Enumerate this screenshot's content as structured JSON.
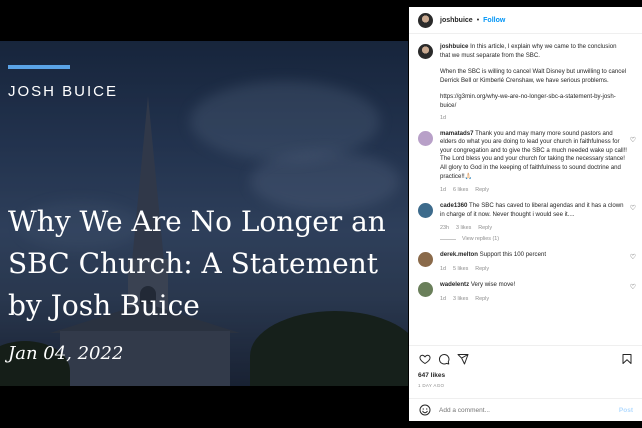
{
  "image": {
    "author": "JOSH BUICE",
    "headline": "Why We Are No Longer an SBC Church: A Statement by Josh Buice",
    "date": "Jan 04, 2022"
  },
  "header": {
    "username": "joshbuice",
    "separator": "•",
    "follow_label": "Follow"
  },
  "caption": {
    "username": "joshbuice",
    "text1": "In this article, I explain why we came to the conclusion that we must separate from the SBC.",
    "text2": "When the SBC is willing to cancel Walt Disney but unwilling to cancel Derrick Bell or Kimberlé Crenshaw, we have serious problems.",
    "link": "https://g3min.org/why-we-are-no-longer-sbc-a-statement-by-josh-buice/",
    "time": "1d"
  },
  "comments": [
    {
      "username": "mamatads7",
      "text": "Thank you and may many more sound pastors and elders do what you are doing to lead your church in faithfulness for your congregation and to give the SBC a much needed wake up call!! The Lord bless you and your church for taking the necessary stance! All glory to God in the keeping of faithfulness to sound doctrine and practice!!🙏🏻",
      "time": "1d",
      "likes": "6 likes",
      "reply": "Reply"
    },
    {
      "username": "cade1360",
      "text": "The SBC has caved to liberal agendas and it has a clown in charge of it now. Never thought i would see it....",
      "time": "23h",
      "likes": "3 likes",
      "reply": "Reply",
      "view_replies": "View replies (1)"
    },
    {
      "username": "derek.melton",
      "text": "Support this 100 percent",
      "time": "1d",
      "likes": "5 likes",
      "reply": "Reply"
    },
    {
      "username": "wadelentz",
      "text": "Very wise move!",
      "time": "1d",
      "likes": "3 likes",
      "reply": "Reply"
    }
  ],
  "actions": {
    "likes": "647 likes",
    "ago": "1 DAY AGO"
  },
  "add_comment": {
    "placeholder": "Add a comment...",
    "post_label": "Post"
  },
  "icons": {
    "like": "heart-icon",
    "comment": "comment-icon",
    "share": "share-icon",
    "save": "bookmark-icon",
    "emoji": "emoji-icon"
  },
  "colors": {
    "follow": "#0095f6",
    "accent_bar": "#5aa3e6"
  }
}
